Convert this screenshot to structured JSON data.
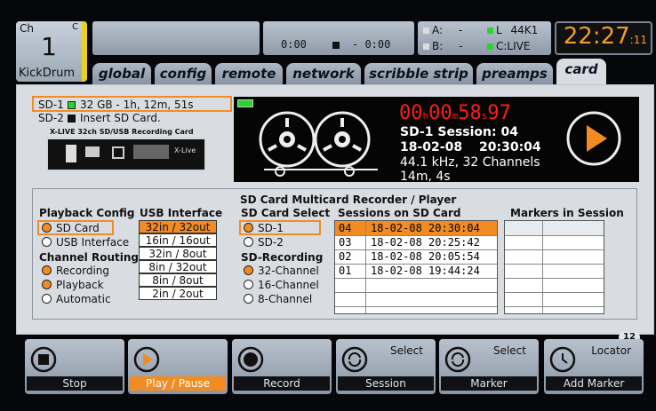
{
  "channel": {
    "ch_label": "Ch",
    "c_label": "C",
    "number": "1",
    "name": "KickDrum"
  },
  "transport": {
    "time_a": "0:00",
    "time_b": "- 0:00"
  },
  "ab_status": {
    "a_label": "A:",
    "a_value": "-",
    "b_label": "B:",
    "b_value": "-",
    "l_label": "L",
    "l_value": "44K1",
    "c_label": "C:",
    "c_value": "LIVE"
  },
  "clock": {
    "time": "22:27",
    "seconds": "11"
  },
  "tabs": [
    {
      "label": "global"
    },
    {
      "label": "config"
    },
    {
      "label": "remote"
    },
    {
      "label": "network"
    },
    {
      "label": "scribble strip"
    },
    {
      "label": "preamps"
    },
    {
      "label": "card"
    }
  ],
  "sd": {
    "sd1_label": "SD-1",
    "sd1_info": "32 GB - 1h, 12m, 51s",
    "sd2_label": "SD-2",
    "sd2_info": "Insert SD Card.",
    "card_caption": "X-LIVE 32ch SD/USB Recording Card",
    "card_brand": "X-Live"
  },
  "recorder": {
    "hours": "00",
    "h": "h",
    "minutes": "00",
    "m": "m",
    "seconds": "58",
    "s": "s",
    "frames": "97",
    "session_line": "SD-1 Session: 04",
    "date": "18-02-08",
    "time": "20:30:04",
    "format": "44.1 kHz, 32 Channels",
    "duration": "14m, 4s"
  },
  "section_title": "SD Card Multicard Recorder / Player",
  "playback_config": {
    "title": "Playback Config",
    "options": [
      "SD Card",
      "USB Interface"
    ]
  },
  "channel_routing": {
    "title": "Channel Routing",
    "options": [
      "Recording",
      "Playback",
      "Automatic"
    ]
  },
  "usb_interface": {
    "title": "USB Interface",
    "items": [
      "32in / 32out",
      "16in / 16out",
      "32in / 8out",
      "8in / 32out",
      "8in / 8out",
      "2in / 2out"
    ]
  },
  "sd_select": {
    "title": "SD Card Select",
    "options": [
      "SD-1",
      "SD-2"
    ]
  },
  "sd_recording": {
    "title": "SD-Recording",
    "options": [
      "32-Channel",
      "16-Channel",
      "8-Channel"
    ]
  },
  "sessions": {
    "title": "Sessions on SD Card",
    "rows": [
      {
        "num": "04",
        "datetime": "18-02-08 20:30:04"
      },
      {
        "num": "03",
        "datetime": "18-02-08 20:25:42"
      },
      {
        "num": "02",
        "datetime": "18-02-08 20:05:54"
      },
      {
        "num": "01",
        "datetime": "18-02-08 19:44:24"
      }
    ]
  },
  "markers": {
    "title": "Markers in Session"
  },
  "page_indicator": {
    "a": "1",
    "b": "2"
  },
  "buttons": [
    {
      "label": "Stop",
      "icon": "stop-icon"
    },
    {
      "label": "Play / Pause",
      "icon": "play-icon"
    },
    {
      "label": "Record",
      "icon": "record-icon"
    },
    {
      "label": "Session",
      "top": "Select",
      "icon": "cycle-icon"
    },
    {
      "label": "Marker",
      "top": "Select",
      "icon": "cycle-icon"
    },
    {
      "label": "Add Marker",
      "top": "Locator",
      "icon": "clock-icon"
    }
  ],
  "colors": {
    "accent": "#f28c22",
    "panel": "#d9dde2",
    "counter_red": "#ff1a1a",
    "clock_orange": "#f29b2b"
  }
}
